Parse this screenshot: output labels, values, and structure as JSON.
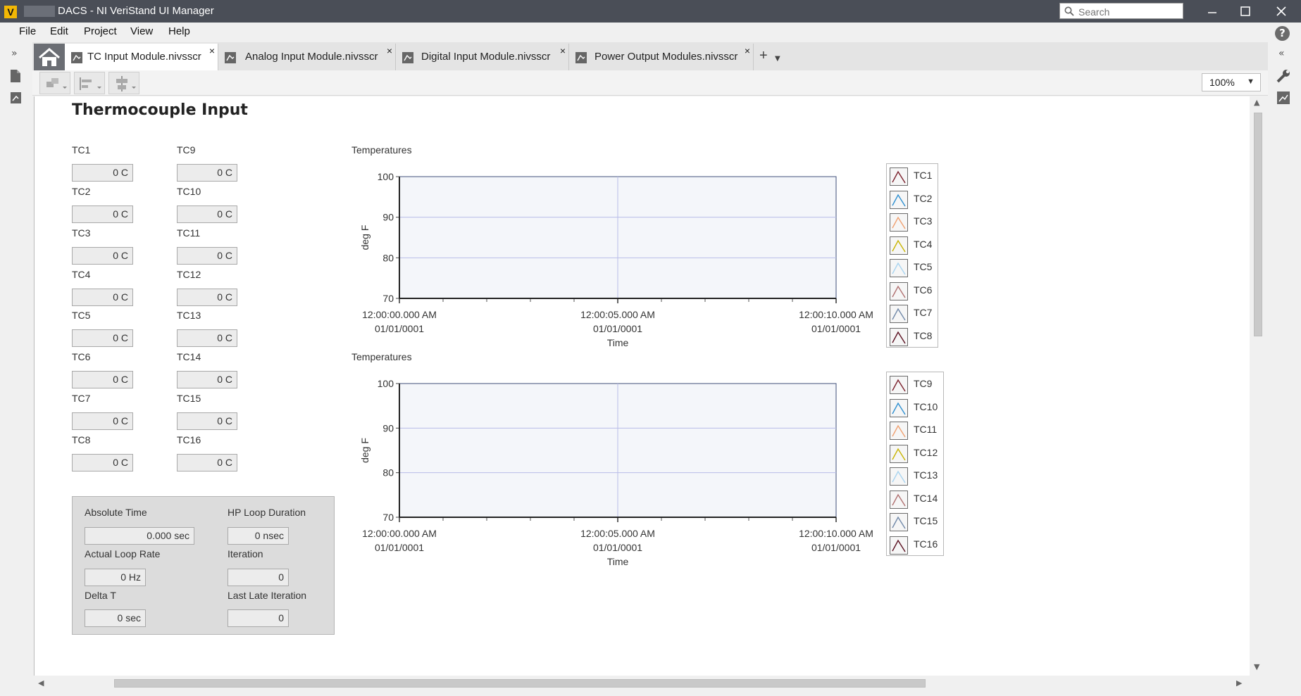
{
  "window": {
    "title": "DACS - NI VeriStand UI Manager",
    "app_icon_letter": "V",
    "search_placeholder": "Search"
  },
  "menu": [
    "File",
    "Edit",
    "Project",
    "View",
    "Help"
  ],
  "tabs": [
    {
      "label": "TC Input Module.nivsscr",
      "active": true
    },
    {
      "label": "Analog Input Module.nivsscr",
      "active": false
    },
    {
      "label": "Digital Input Module.nivsscr",
      "active": false
    },
    {
      "label": "Power Output Modules.nivsscr",
      "active": false
    }
  ],
  "toolbar": {
    "zoom": "100%"
  },
  "screen": {
    "title": "Thermocouple Input",
    "indicators_left": [
      {
        "label": "TC1",
        "value": "0 C"
      },
      {
        "label": "TC2",
        "value": "0 C"
      },
      {
        "label": "TC3",
        "value": "0 C"
      },
      {
        "label": "TC4",
        "value": "0 C"
      },
      {
        "label": "TC5",
        "value": "0 C"
      },
      {
        "label": "TC6",
        "value": "0 C"
      },
      {
        "label": "TC7",
        "value": "0 C"
      },
      {
        "label": "TC8",
        "value": "0 C"
      }
    ],
    "indicators_right": [
      {
        "label": "TC9",
        "value": "0 C"
      },
      {
        "label": "TC10",
        "value": "0 C"
      },
      {
        "label": "TC11",
        "value": "0 C"
      },
      {
        "label": "TC12",
        "value": "0 C"
      },
      {
        "label": "TC13",
        "value": "0 C"
      },
      {
        "label": "TC14",
        "value": "0 C"
      },
      {
        "label": "TC15",
        "value": "0 C"
      },
      {
        "label": "TC16",
        "value": "0 C"
      }
    ],
    "status": {
      "absolute_time": {
        "label": "Absolute Time",
        "value": "0.000 sec"
      },
      "hp_loop_duration": {
        "label": "HP Loop Duration",
        "value": "0 nsec"
      },
      "actual_loop_rate": {
        "label": "Actual Loop Rate",
        "value": "0 Hz"
      },
      "iteration": {
        "label": "Iteration",
        "value": "0"
      },
      "delta_t": {
        "label": "Delta T",
        "value": "0 sec"
      },
      "last_late_iteration": {
        "label": "Last Late Iteration",
        "value": "0"
      }
    }
  },
  "colors": {
    "titlebar": "#4a4e57",
    "plot_bg": "#f4f6fa",
    "grid": "#b9bce8",
    "plot_border": "#3f4f7a"
  },
  "chart_data": [
    {
      "type": "line",
      "title": "Temperatures",
      "xlabel": "Time",
      "ylabel": "deg F",
      "ylim": [
        70,
        100
      ],
      "yticks": [
        "100",
        "90",
        "80",
        "70"
      ],
      "xticks": [
        {
          "time": "12:00:00.000 AM",
          "date": "01/01/0001"
        },
        {
          "time": "12:00:05.000 AM",
          "date": "01/01/0001"
        },
        {
          "time": "12:00:10.000 AM",
          "date": "01/01/0001"
        }
      ],
      "grid": true,
      "legend_position": "right",
      "series": [
        {
          "name": "TC1",
          "color": "#7a1f2b",
          "values": []
        },
        {
          "name": "TC2",
          "color": "#2e8fd0",
          "values": []
        },
        {
          "name": "TC3",
          "color": "#f0a070",
          "values": []
        },
        {
          "name": "TC4",
          "color": "#c8b400",
          "values": []
        },
        {
          "name": "TC5",
          "color": "#a8d4f0",
          "values": []
        },
        {
          "name": "TC6",
          "color": "#b07070",
          "values": []
        },
        {
          "name": "TC7",
          "color": "#7088a8",
          "values": []
        },
        {
          "name": "TC8",
          "color": "#5a1020",
          "values": []
        }
      ]
    },
    {
      "type": "line",
      "title": "Temperatures",
      "xlabel": "Time",
      "ylabel": "deg F",
      "ylim": [
        70,
        100
      ],
      "yticks": [
        "100",
        "90",
        "80",
        "70"
      ],
      "xticks": [
        {
          "time": "12:00:00.000 AM",
          "date": "01/01/0001"
        },
        {
          "time": "12:00:05.000 AM",
          "date": "01/01/0001"
        },
        {
          "time": "12:00:10.000 AM",
          "date": "01/01/0001"
        }
      ],
      "grid": true,
      "legend_position": "right",
      "series": [
        {
          "name": "TC9",
          "color": "#7a1f2b",
          "values": []
        },
        {
          "name": "TC10",
          "color": "#2e8fd0",
          "values": []
        },
        {
          "name": "TC11",
          "color": "#f0a070",
          "values": []
        },
        {
          "name": "TC12",
          "color": "#c8b400",
          "values": []
        },
        {
          "name": "TC13",
          "color": "#a8d4f0",
          "values": []
        },
        {
          "name": "TC14",
          "color": "#b07070",
          "values": []
        },
        {
          "name": "TC15",
          "color": "#7088a8",
          "values": []
        },
        {
          "name": "TC16",
          "color": "#5a1020",
          "values": []
        }
      ]
    }
  ]
}
